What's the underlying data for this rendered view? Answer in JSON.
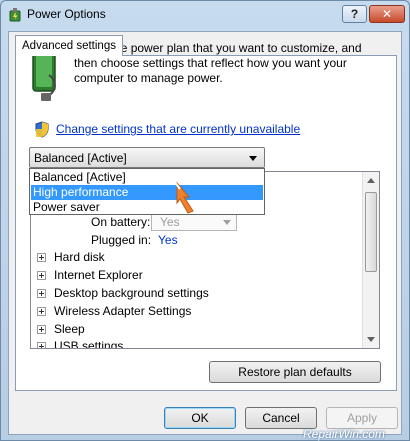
{
  "window": {
    "title": "Power Options",
    "help_label": "?",
    "close_label": "✕"
  },
  "tab": {
    "label": "Advanced settings"
  },
  "intro": {
    "text": "Select the power plan that you want to customize, and then choose settings that reflect how you want your computer to manage power."
  },
  "change_link": "Change settings that are currently unavailable",
  "plan_select": {
    "selected": "Balanced [Active]",
    "options": [
      "Balanced [Active]",
      "High performance",
      "Power saver"
    ],
    "highlighted": "High performance"
  },
  "settings": {
    "on_battery_label": "On battery:",
    "on_battery_value": "Yes",
    "plugged_in_label": "Plugged in:",
    "plugged_in_value": "Yes",
    "tree": [
      "Hard disk",
      "Internet Explorer",
      "Desktop background settings",
      "Wireless Adapter Settings",
      "Sleep",
      "USB settings"
    ]
  },
  "buttons": {
    "restore": "Restore plan defaults",
    "ok": "OK",
    "cancel": "Cancel",
    "apply": "Apply"
  },
  "watermark": "RepairWin.com",
  "icons": {
    "title": "power-options-icon",
    "battery": "battery-plug-icon",
    "shield": "uac-shield-icon",
    "cursor": "mouse-pointer-arrow-icon"
  },
  "colors": {
    "link": "#0033cc",
    "selection": "#3399ff",
    "cursor": "#f08030"
  }
}
